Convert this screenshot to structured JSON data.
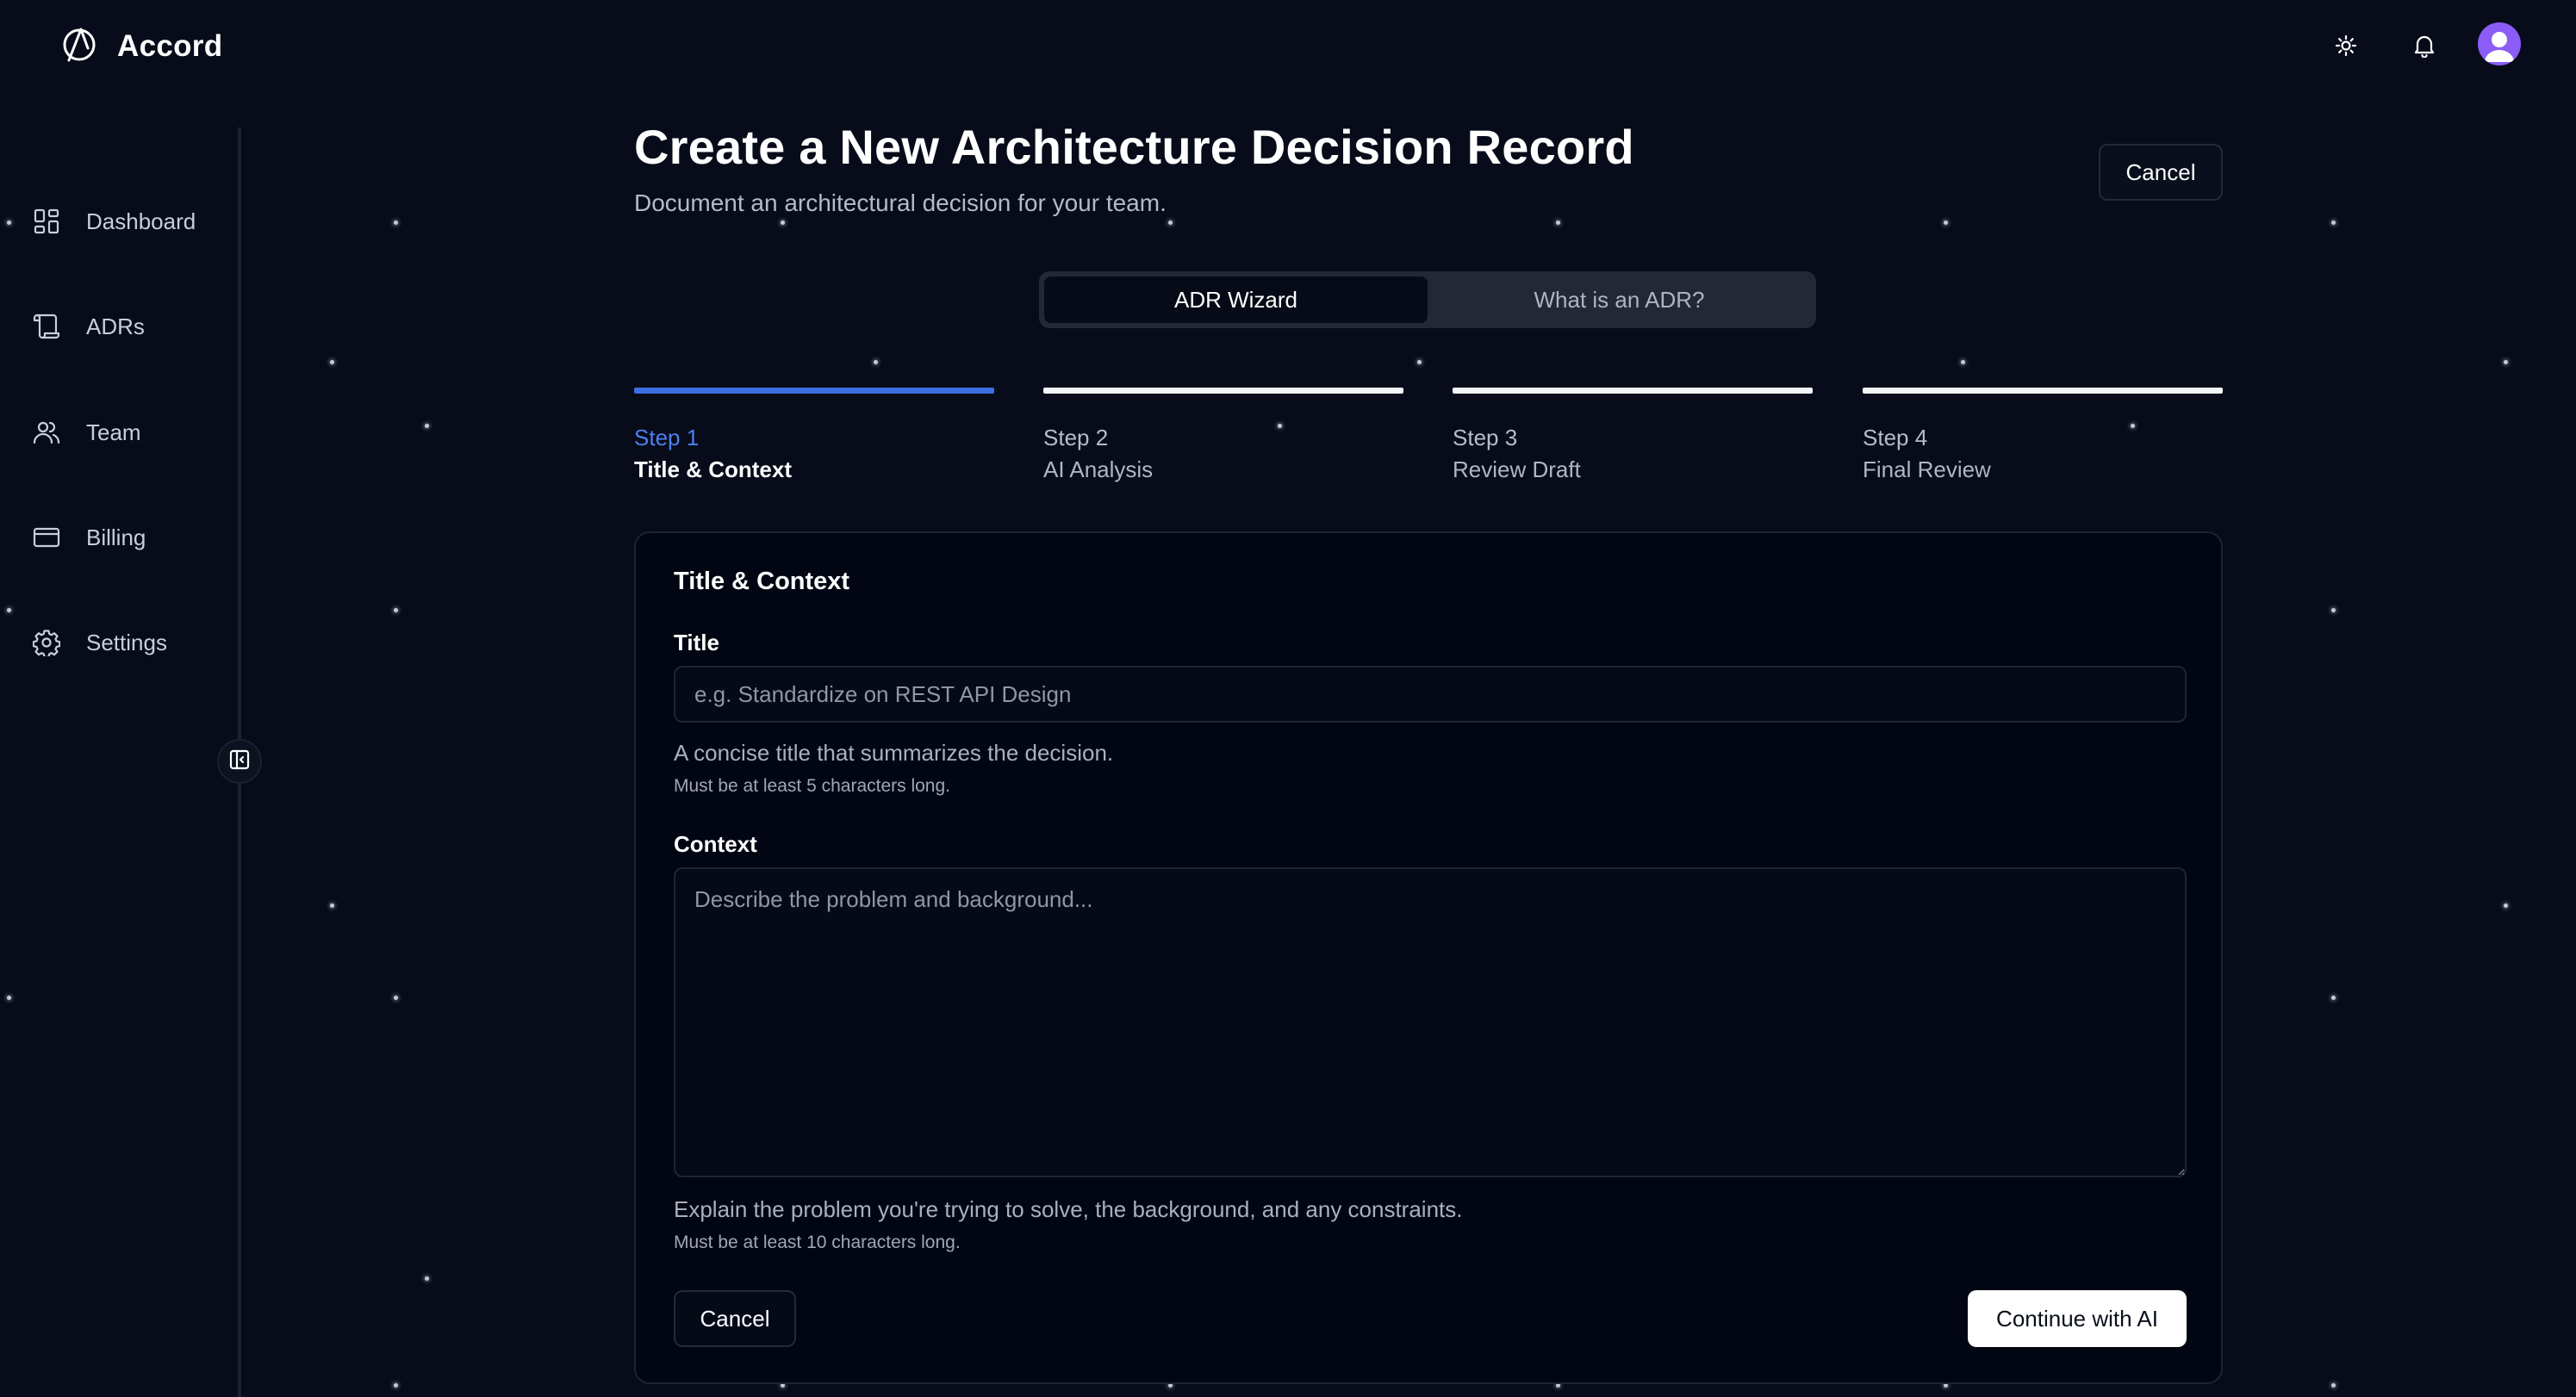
{
  "app": {
    "name": "Accord"
  },
  "header": {
    "theme_icon": "sun-icon",
    "notifications_icon": "bell-icon",
    "avatar_icon": "user-avatar"
  },
  "sidebar": {
    "items": [
      {
        "label": "Dashboard",
        "icon": "dashboard-grid-icon"
      },
      {
        "label": "ADRs",
        "icon": "scroll-icon"
      },
      {
        "label": "Team",
        "icon": "users-icon"
      },
      {
        "label": "Billing",
        "icon": "credit-card-icon"
      },
      {
        "label": "Settings",
        "icon": "gear-icon"
      }
    ],
    "collapse_icon": "sidebar-collapse-icon"
  },
  "page": {
    "title": "Create a New Architecture Decision Record",
    "subtitle": "Document an architectural decision for your team.",
    "cancel_label": "Cancel"
  },
  "tabs": [
    {
      "label": "ADR Wizard",
      "active": true
    },
    {
      "label": "What is an ADR?",
      "active": false
    }
  ],
  "steps": [
    {
      "number": "Step 1",
      "name": "Title & Context",
      "active": true
    },
    {
      "number": "Step 2",
      "name": "AI Analysis",
      "active": false
    },
    {
      "number": "Step 3",
      "name": "Review Draft",
      "active": false
    },
    {
      "number": "Step 4",
      "name": "Final Review",
      "active": false
    }
  ],
  "form": {
    "heading": "Title & Context",
    "title_field": {
      "label": "Title",
      "value": "",
      "placeholder": "e.g. Standardize on REST API Design",
      "help": "A concise title that summarizes the decision.",
      "hint": "Must be at least 5 characters long."
    },
    "context_field": {
      "label": "Context",
      "value": "",
      "placeholder": "Describe the problem and background...",
      "help": "Explain the problem you're trying to solve, the background, and any constraints.",
      "hint": "Must be at least 10 characters long."
    },
    "cancel_label": "Cancel",
    "continue_label": "Continue with AI"
  },
  "colors": {
    "background": "#080c1a",
    "accent": "#3d6fe3",
    "step_active_text": "#4f7ff0",
    "avatar": "#8b5cf6",
    "card": "#020613"
  }
}
